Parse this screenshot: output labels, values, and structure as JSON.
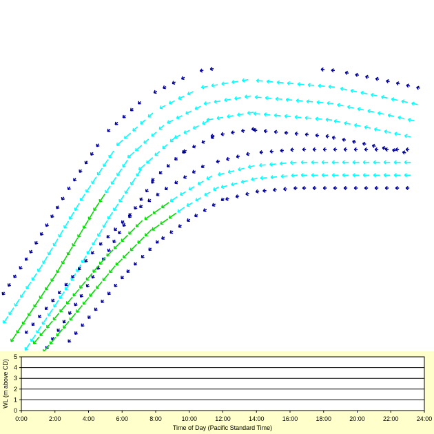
{
  "colors": {
    "slow": "#000099",
    "medium": "#00ffff",
    "fast": "#00dd00",
    "panel_bg": "#ffffcc",
    "plot_bg": "#ffffff"
  },
  "vector_map": {
    "flow_direction": "ebb toward lower-left",
    "channels": [
      {
        "name": "north",
        "centerline": [
          [
            20,
            490
          ],
          [
            80,
            400
          ],
          [
            140,
            300
          ],
          [
            190,
            225
          ],
          [
            240,
            180
          ],
          [
            300,
            150
          ],
          [
            360,
            140
          ],
          [
            420,
            145
          ],
          [
            480,
            150
          ],
          [
            540,
            162
          ],
          [
            600,
            175
          ]
        ],
        "half_width": 48
      },
      {
        "name": "south",
        "centerline": [
          [
            60,
            500
          ],
          [
            110,
            440
          ],
          [
            160,
            380
          ],
          [
            210,
            330
          ],
          [
            260,
            295
          ],
          [
            310,
            265
          ],
          [
            370,
            250
          ],
          [
            430,
            245
          ],
          [
            490,
            245
          ],
          [
            550,
            245
          ],
          [
            605,
            245
          ]
        ],
        "half_width": 28
      }
    ]
  },
  "chart_data": {
    "type": "line",
    "title": "",
    "xlabel": "Time of Day (Pacific Standard Time)",
    "ylabel": "WL (m above CD)",
    "xlim": [
      0,
      24
    ],
    "ylim": [
      0,
      5
    ],
    "x_ticks": [
      "0:00",
      "2:00",
      "4:00",
      "6:00",
      "8:00",
      "10:00",
      "12:00",
      "14:00",
      "16:00",
      "18:00",
      "20:00",
      "22:00",
      "24:00"
    ],
    "y_ticks": [
      "0",
      "1",
      "2",
      "3",
      "4",
      "5"
    ],
    "grid": true,
    "series": []
  }
}
